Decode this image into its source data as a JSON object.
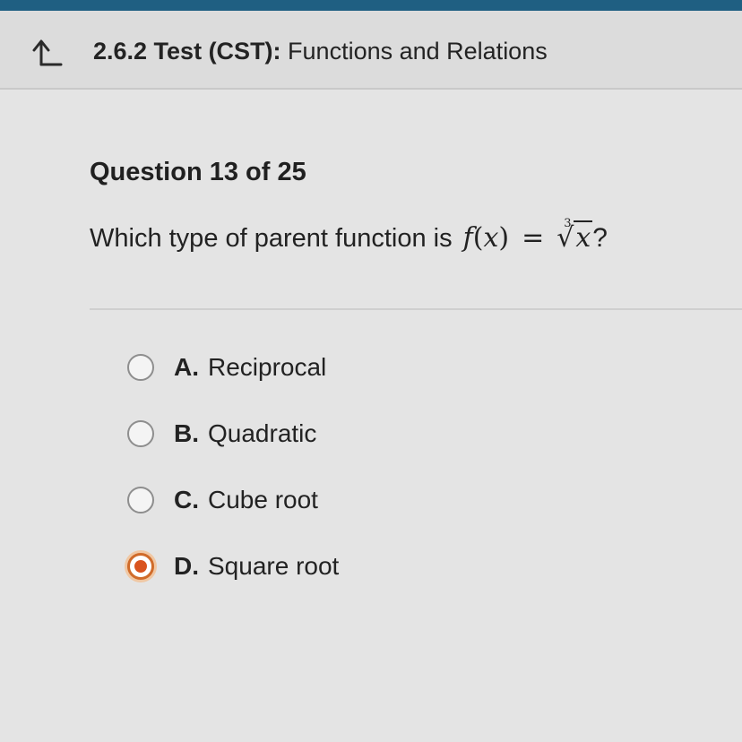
{
  "header": {
    "back_icon": "up-arrow-back-icon",
    "title_bold": "2.6.2 Test (CST):",
    "title_rest": " Functions and Relations"
  },
  "question": {
    "number_label": "Question 13 of 25",
    "prompt": "Which type of parent function is",
    "math": {
      "f": "f",
      "lparen": "(",
      "var": "x",
      "rparen": ")",
      "equals": "=",
      "root_index": "3",
      "radical": "√",
      "radicand": "x",
      "end": "?"
    }
  },
  "options": [
    {
      "letter": "A.",
      "text": "Reciprocal",
      "selected": false
    },
    {
      "letter": "B.",
      "text": "Quadratic",
      "selected": false
    },
    {
      "letter": "C.",
      "text": "Cube root",
      "selected": false
    },
    {
      "letter": "D.",
      "text": "Square root",
      "selected": true
    }
  ],
  "colors": {
    "top_bar": "#1f5f82",
    "selected_accent": "#d9531e"
  }
}
